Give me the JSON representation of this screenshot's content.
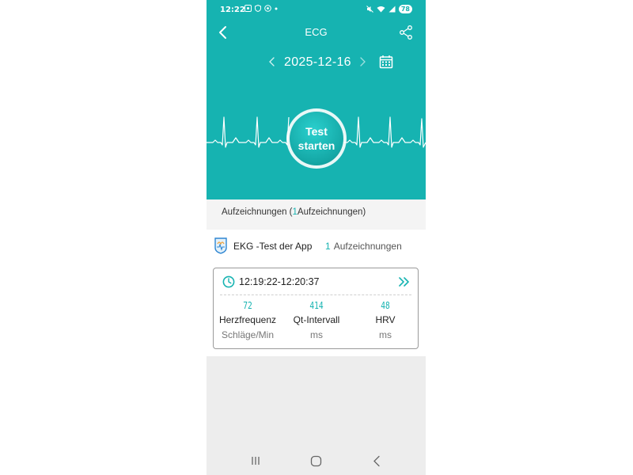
{
  "status_bar": {
    "time": "12:22",
    "battery": "78"
  },
  "app_bar": {
    "title": "ECG"
  },
  "date_nav": {
    "date": "2025-12-16"
  },
  "start_button": {
    "line1": "Test",
    "line2": "starten"
  },
  "records_header": {
    "prefix": "Aufzeichnungen (",
    "count": "1",
    "suffix": "Aufzeichnungen)"
  },
  "app_row": {
    "name": "EKG -Test der App",
    "count": "1",
    "count_label": "Aufzeichnungen"
  },
  "record": {
    "time_range": "12:19:22-12:20:37",
    "metrics": [
      {
        "value": "72",
        "label": "Herzfrequenz",
        "unit": "Schläge/Min"
      },
      {
        "value": "414",
        "label": "Qt-Intervall",
        "unit": "ms"
      },
      {
        "value": "48",
        "label": "HRV",
        "unit": "ms"
      }
    ]
  },
  "colors": {
    "accent": "#16b3b1",
    "background": "#ededed"
  },
  "icons": {
    "back": "back-arrow-icon",
    "share": "share-icon",
    "calendar": "calendar-icon",
    "clock": "clock-icon",
    "more": "double-chevron-right-icon"
  }
}
